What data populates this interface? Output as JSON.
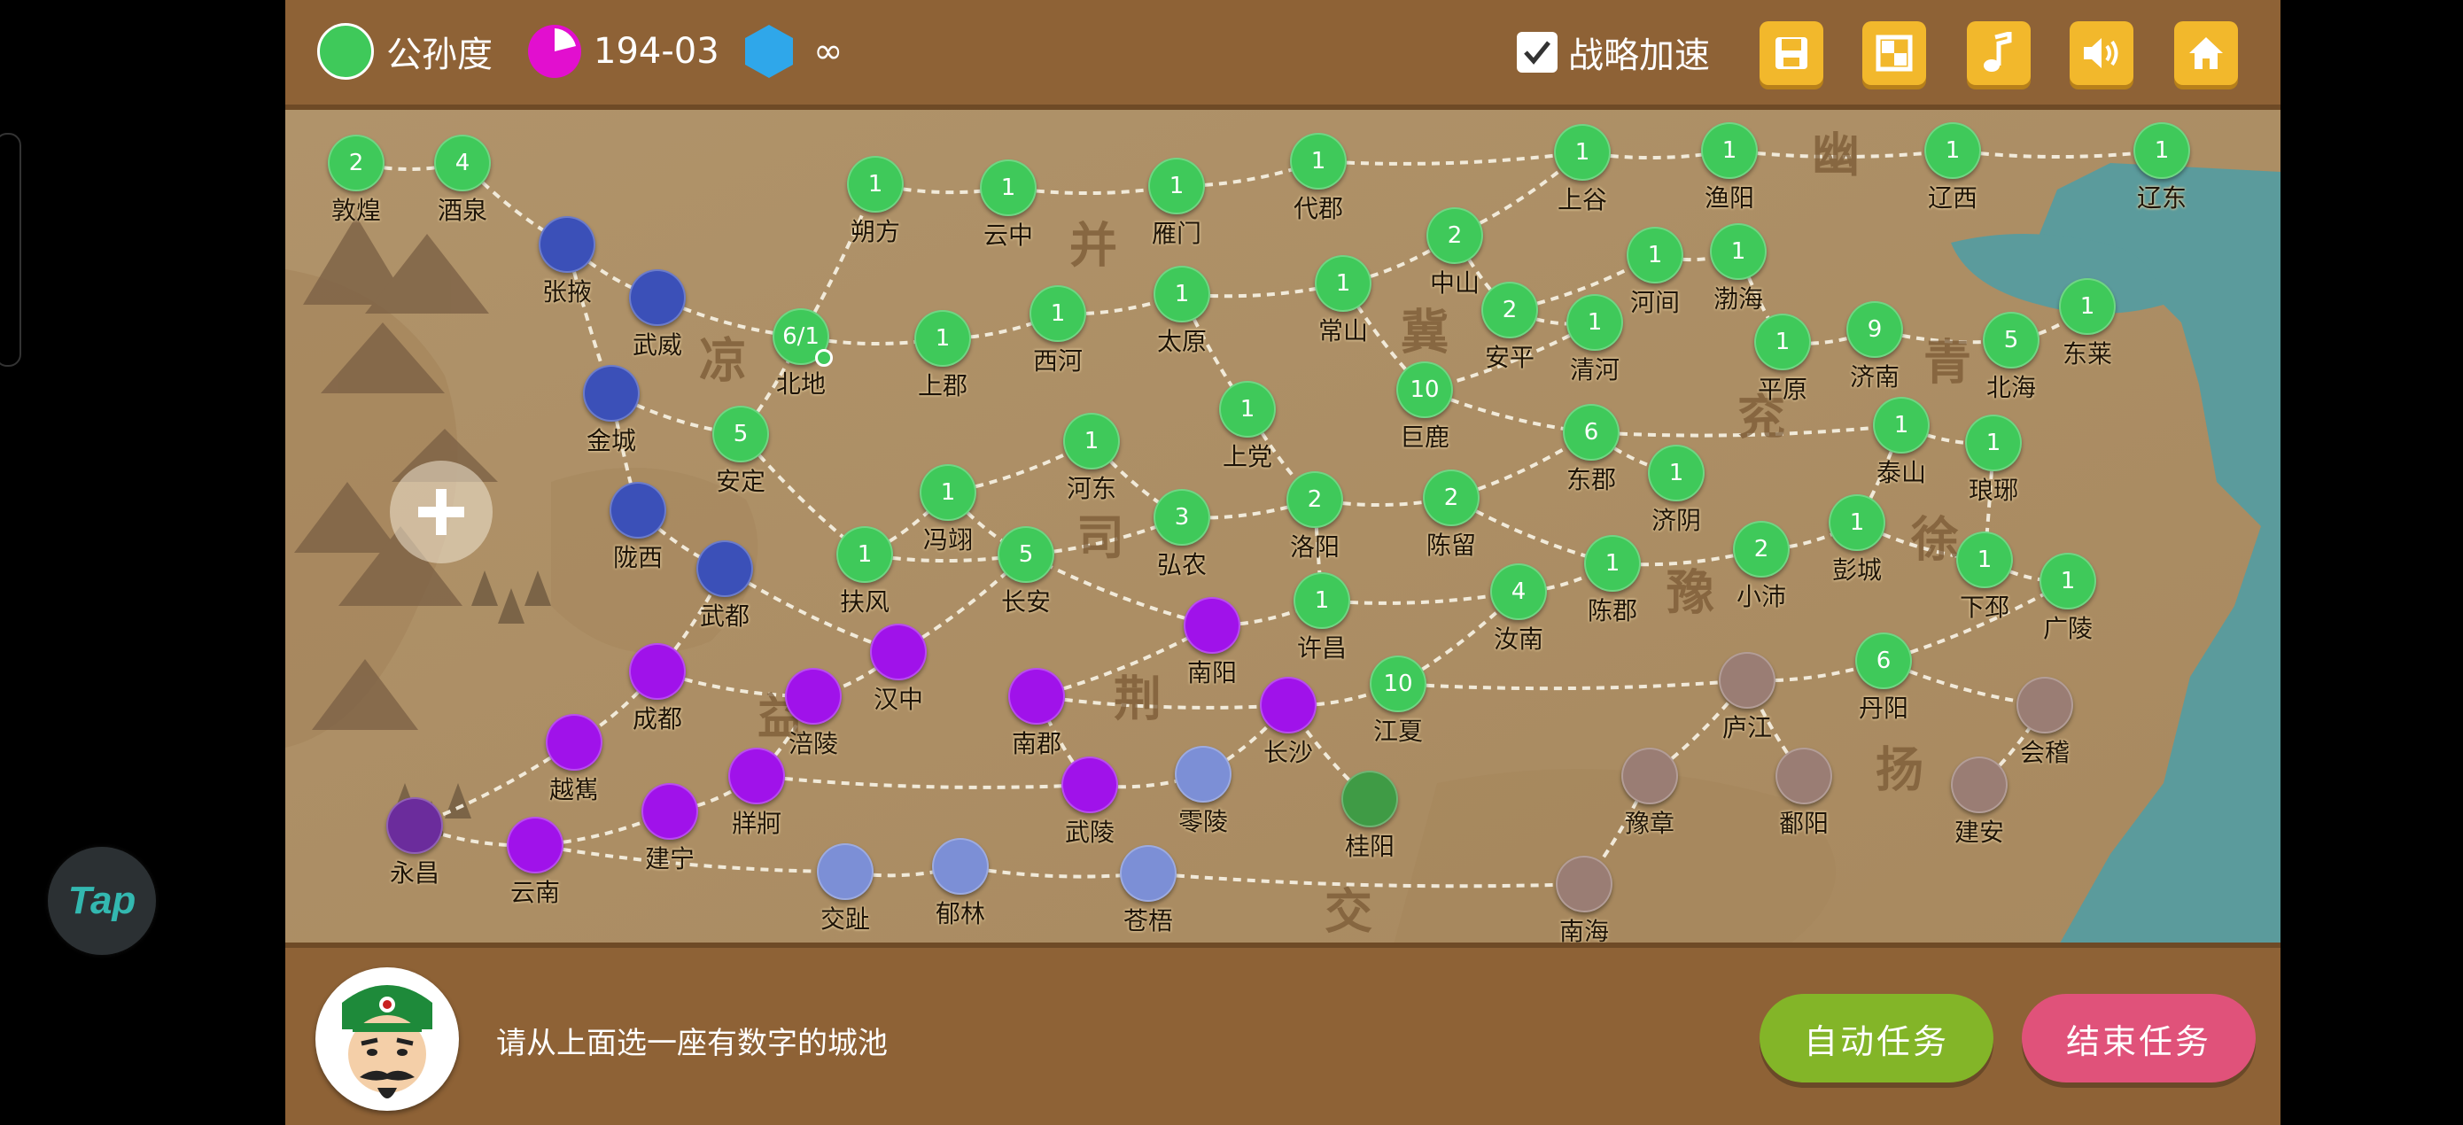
{
  "left_overlay": {
    "tap_label": "Tap"
  },
  "header": {
    "faction_name": "公孙度",
    "faction_color": "#3fc95a",
    "date": "194-03",
    "resource_value": "∞",
    "speed_label": "战略加速",
    "speed_checked": true,
    "buttons": [
      "save-icon",
      "window-icon",
      "music-icon",
      "volume-icon",
      "home-icon"
    ]
  },
  "footer": {
    "instruction": "请从上面选一座有数字的城池",
    "auto_button": "自动任务",
    "end_button": "结束任务"
  },
  "colors": {
    "green": "#3fc95a",
    "darkgreen": "#3f9b45",
    "blue": "#3b50b8",
    "purple": "#a012ea",
    "indigo": "#6b2c9c",
    "periwinkle": "#7c8fd6",
    "taupe": "#9a7d74"
  },
  "regions": [
    "幽",
    "并",
    "冀",
    "凉",
    "青",
    "兖",
    "司",
    "徐",
    "豫",
    "益",
    "荆",
    "扬",
    "交"
  ],
  "cities": [
    {
      "name": "敦煌",
      "value": "2",
      "color": "green"
    },
    {
      "name": "酒泉",
      "value": "4",
      "color": "green"
    },
    {
      "name": "张掖",
      "value": "",
      "color": "blue"
    },
    {
      "name": "武威",
      "value": "",
      "color": "blue"
    },
    {
      "name": "金城",
      "value": "",
      "color": "blue"
    },
    {
      "name": "陇西",
      "value": "",
      "color": "blue"
    },
    {
      "name": "武都",
      "value": "",
      "color": "blue"
    },
    {
      "name": "北地",
      "value": "6/1",
      "color": "green"
    },
    {
      "name": "安定",
      "value": "5",
      "color": "green"
    },
    {
      "name": "朔方",
      "value": "1",
      "color": "green"
    },
    {
      "name": "云中",
      "value": "1",
      "color": "green"
    },
    {
      "name": "雁门",
      "value": "1",
      "color": "green"
    },
    {
      "name": "代郡",
      "value": "1",
      "color": "green"
    },
    {
      "name": "上谷",
      "value": "1",
      "color": "green"
    },
    {
      "name": "渔阳",
      "value": "1",
      "color": "green"
    },
    {
      "name": "辽西",
      "value": "1",
      "color": "green"
    },
    {
      "name": "辽东",
      "value": "1",
      "color": "green"
    },
    {
      "name": "上郡",
      "value": "1",
      "color": "green"
    },
    {
      "name": "西河",
      "value": "1",
      "color": "green"
    },
    {
      "name": "太原",
      "value": "1",
      "color": "green"
    },
    {
      "name": "常山",
      "value": "1",
      "color": "green"
    },
    {
      "name": "中山",
      "value": "2",
      "color": "green"
    },
    {
      "name": "安平",
      "value": "2",
      "color": "green"
    },
    {
      "name": "河间",
      "value": "1",
      "color": "green"
    },
    {
      "name": "渤海",
      "value": "1",
      "color": "green"
    },
    {
      "name": "清河",
      "value": "1",
      "color": "green"
    },
    {
      "name": "平原",
      "value": "1",
      "color": "green"
    },
    {
      "name": "济南",
      "value": "9",
      "color": "green"
    },
    {
      "name": "北海",
      "value": "5",
      "color": "green"
    },
    {
      "name": "东莱",
      "value": "1",
      "color": "green"
    },
    {
      "name": "上党",
      "value": "1",
      "color": "green"
    },
    {
      "name": "巨鹿",
      "value": "10",
      "color": "green"
    },
    {
      "name": "东郡",
      "value": "6",
      "color": "green"
    },
    {
      "name": "泰山",
      "value": "1",
      "color": "green"
    },
    {
      "name": "琅琊",
      "value": "1",
      "color": "green"
    },
    {
      "name": "济阴",
      "value": "1",
      "color": "green"
    },
    {
      "name": "河东",
      "value": "1",
      "color": "green"
    },
    {
      "name": "冯翊",
      "value": "1",
      "color": "green"
    },
    {
      "name": "弘农",
      "value": "3",
      "color": "green"
    },
    {
      "name": "洛阳",
      "value": "2",
      "color": "green"
    },
    {
      "name": "陈留",
      "value": "2",
      "color": "green"
    },
    {
      "name": "扶风",
      "value": "1",
      "color": "green"
    },
    {
      "name": "长安",
      "value": "5",
      "color": "green"
    },
    {
      "name": "陈郡",
      "value": "1",
      "color": "green"
    },
    {
      "name": "小沛",
      "value": "2",
      "color": "green"
    },
    {
      "name": "彭城",
      "value": "1",
      "color": "green"
    },
    {
      "name": "下邳",
      "value": "1",
      "color": "green"
    },
    {
      "name": "广陵",
      "value": "1",
      "color": "green"
    },
    {
      "name": "许昌",
      "value": "1",
      "color": "green"
    },
    {
      "name": "汝南",
      "value": "4",
      "color": "green"
    },
    {
      "name": "南阳",
      "value": "",
      "color": "purple"
    },
    {
      "name": "汉中",
      "value": "",
      "color": "purple"
    },
    {
      "name": "成都",
      "value": "",
      "color": "purple"
    },
    {
      "name": "涪陵",
      "value": "",
      "color": "purple"
    },
    {
      "name": "南郡",
      "value": "",
      "color": "purple"
    },
    {
      "name": "长沙",
      "value": "",
      "color": "purple"
    },
    {
      "name": "江夏",
      "value": "10",
      "color": "green"
    },
    {
      "name": "庐江",
      "value": "",
      "color": "taupe"
    },
    {
      "name": "丹阳",
      "value": "6",
      "color": "green"
    },
    {
      "name": "会稽",
      "value": "",
      "color": "taupe"
    },
    {
      "name": "越嶲",
      "value": "",
      "color": "purple"
    },
    {
      "name": "牂牁",
      "value": "",
      "color": "purple"
    },
    {
      "name": "建宁",
      "value": "",
      "color": "purple"
    },
    {
      "name": "永昌",
      "value": "",
      "color": "indigo"
    },
    {
      "name": "云南",
      "value": "",
      "color": "purple"
    },
    {
      "name": "武陵",
      "value": "",
      "color": "purple"
    },
    {
      "name": "零陵",
      "value": "",
      "color": "periwinkle"
    },
    {
      "name": "桂阳",
      "value": "",
      "color": "darkgreen"
    },
    {
      "name": "豫章",
      "value": "",
      "color": "taupe"
    },
    {
      "name": "鄱阳",
      "value": "",
      "color": "taupe"
    },
    {
      "name": "建安",
      "value": "",
      "color": "taupe"
    },
    {
      "name": "交趾",
      "value": "",
      "color": "periwinkle"
    },
    {
      "name": "郁林",
      "value": "",
      "color": "periwinkle"
    },
    {
      "name": "苍梧",
      "value": "",
      "color": "periwinkle"
    },
    {
      "name": "南海",
      "value": "",
      "color": "taupe"
    }
  ]
}
